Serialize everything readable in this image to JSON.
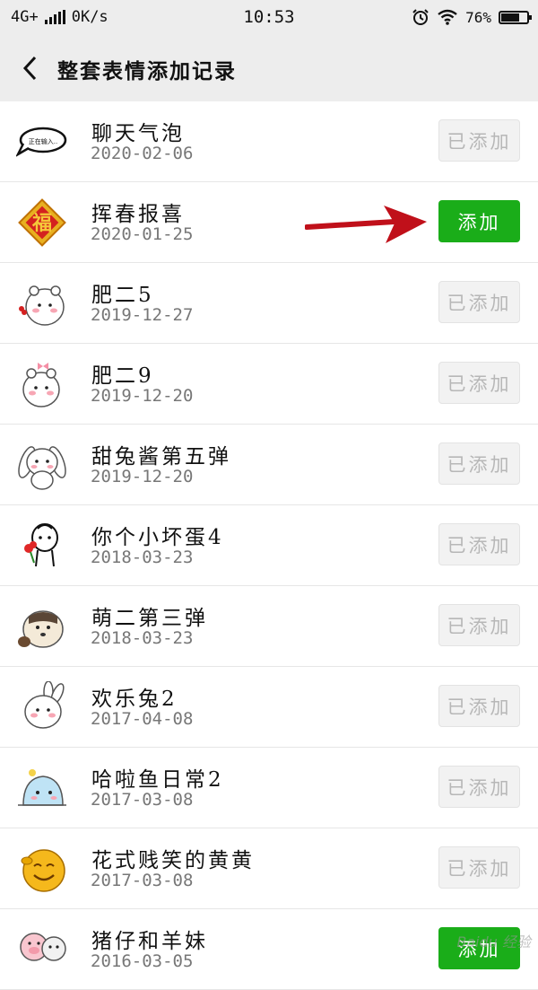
{
  "status_bar": {
    "network": "4G+",
    "speed": "0K/s",
    "time": "10:53",
    "battery_percent": "76%",
    "battery_level": 0.76,
    "icons": [
      "signal-icon",
      "alarm-icon",
      "wifi-icon",
      "battery-icon"
    ]
  },
  "header": {
    "title": "整套表情添加记录",
    "back_icon": "back-arrow-icon"
  },
  "colors": {
    "add_button": "#1aad19",
    "added_button_bg": "#f2f2f2",
    "added_button_text": "#b7b7b7",
    "annotation_arrow": "#c0101a"
  },
  "list": {
    "items": [
      {
        "name": "聊天气泡",
        "date": "2020-02-06",
        "button": "已添加",
        "added": true,
        "thumb_icon": "speech-bubble-sticker",
        "thumb_text": "正在输入.."
      },
      {
        "name": "挥春报喜",
        "date": "2020-01-25",
        "button": "添加",
        "added": false,
        "thumb_icon": "fu-couplet-sticker",
        "thumb_text": "福"
      },
      {
        "name": "肥二5",
        "date": "2019-12-27",
        "button": "已添加",
        "added": true,
        "thumb_icon": "chubby-bear-sticker"
      },
      {
        "name": "肥二9",
        "date": "2019-12-20",
        "button": "已添加",
        "added": true,
        "thumb_icon": "chubby-bear-bow-sticker"
      },
      {
        "name": "甜兔酱第五弹",
        "date": "2019-12-20",
        "button": "已添加",
        "added": true,
        "thumb_icon": "bunny-sticker"
      },
      {
        "name": "你个小坏蛋4",
        "date": "2018-03-23",
        "button": "已添加",
        "added": true,
        "thumb_icon": "little-guy-flower-sticker"
      },
      {
        "name": "萌二第三弹",
        "date": "2018-03-23",
        "button": "已添加",
        "added": true,
        "thumb_icon": "raccoon-sticker"
      },
      {
        "name": "欢乐兔2",
        "date": "2017-04-08",
        "button": "已添加",
        "added": true,
        "thumb_icon": "happy-rabbit-sticker"
      },
      {
        "name": "哈啦鱼日常2",
        "date": "2017-03-08",
        "button": "已添加",
        "added": true,
        "thumb_icon": "blue-fish-sticker"
      },
      {
        "name": "花式贱笑的黄黄",
        "date": "2017-03-08",
        "button": "已添加",
        "added": true,
        "thumb_icon": "yellow-smiley-sticker"
      },
      {
        "name": "猪仔和羊妹",
        "date": "2016-03-05",
        "button": "添加",
        "added": false,
        "thumb_icon": "pig-sheep-sticker"
      }
    ]
  },
  "watermark": "Baidu 经验"
}
